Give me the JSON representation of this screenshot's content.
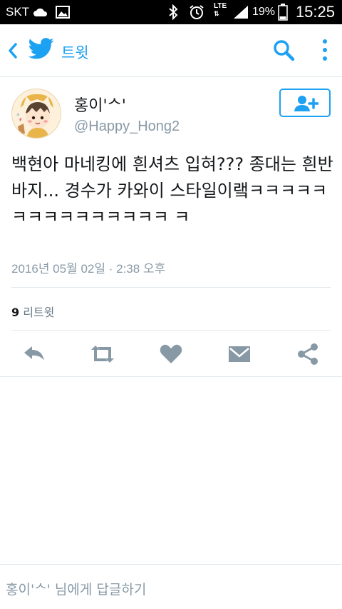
{
  "status_bar": {
    "carrier": "SKT",
    "lte": "LTE",
    "battery": "19%",
    "time": "15:25"
  },
  "header": {
    "title": "트윗",
    "back_icon": "back-chevron-icon",
    "logo_icon": "twitter-bird-icon",
    "search_icon": "search-icon",
    "more_icon": "more-vertical-icon"
  },
  "tweet": {
    "author_name": "홍이'ᄉ'",
    "author_handle": "@Happy_Hong2",
    "text": "백현아 마네킹에 흰셔츠 입혀??? 종대는 흰반바지... 경수가 카와이 스타일이랰ㅋㅋㅋㅋㅋㅋㅋㅋㅋㅋㅋㅋㅋㅋㅋ ㅋ",
    "date": "2016년 05월 02일",
    "separator": " · ",
    "time": "2:38 오후",
    "retweet_count": "9",
    "retweet_label": "리트윗"
  },
  "actions": [
    "reply-icon",
    "retweet-icon",
    "like-icon",
    "message-icon",
    "share-icon"
  ],
  "reply_bar": {
    "placeholder": "홍이'ᄉ' 님에게 답글하기"
  },
  "colors": {
    "accent": "#1da1f2",
    "icon_gray": "#8899a6",
    "text": "#14171a"
  }
}
